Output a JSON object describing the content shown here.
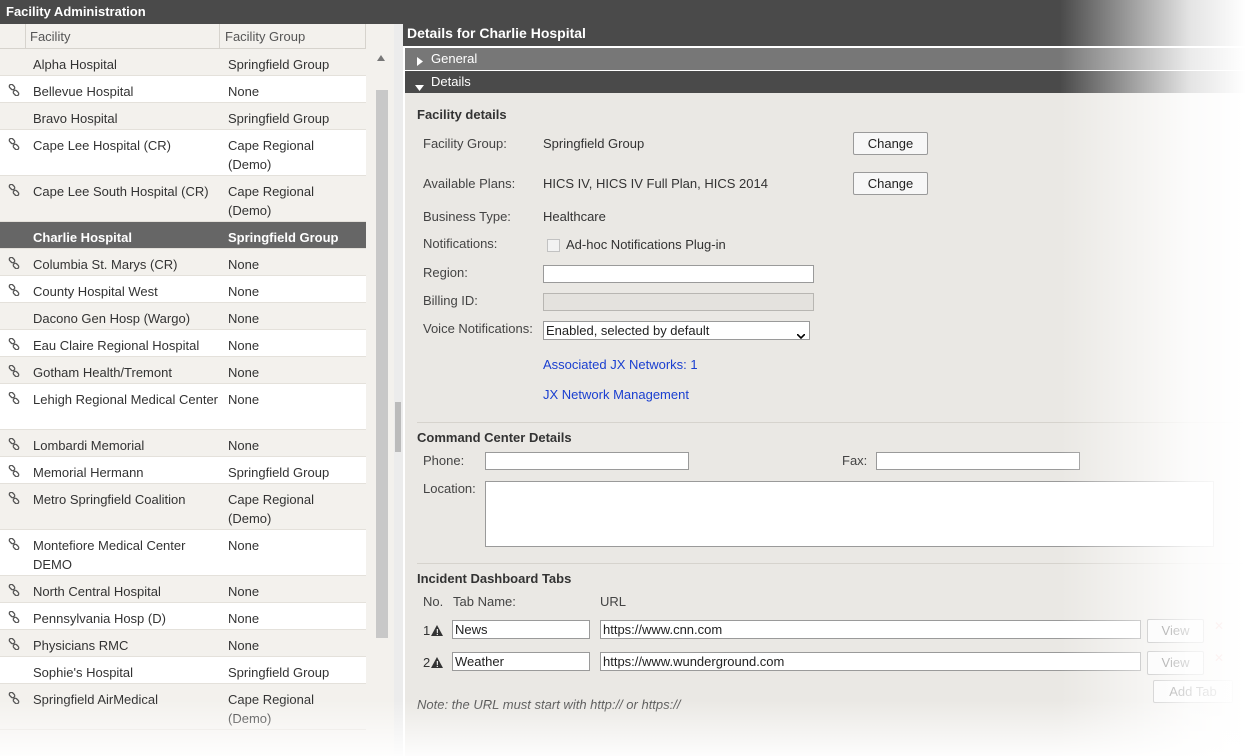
{
  "app_title": "Facility Administration",
  "left": {
    "headers": {
      "facility": "Facility",
      "group": "Facility Group"
    },
    "rows": [
      {
        "facility": "Alpha Hospital",
        "group": "Springfield Group",
        "linked": false
      },
      {
        "facility": "Bellevue Hospital",
        "group": "None",
        "linked": true
      },
      {
        "facility": "Bravo Hospital",
        "group": "Springfield Group",
        "linked": false
      },
      {
        "facility": "Cape Lee Hospital (CR)",
        "group": "Cape Regional (Demo)",
        "linked": true
      },
      {
        "facility": "Cape Lee South Hospital (CR)",
        "group": "Cape Regional (Demo)",
        "linked": true
      },
      {
        "facility": "Charlie Hospital",
        "group": "Springfield Group",
        "linked": false,
        "selected": true
      },
      {
        "facility": "Columbia St. Marys (CR)",
        "group": "None",
        "linked": true
      },
      {
        "facility": "County Hospital West",
        "group": "None",
        "linked": true
      },
      {
        "facility": "Dacono Gen Hosp (Wargo)",
        "group": "None",
        "linked": false
      },
      {
        "facility": "Eau Claire Regional Hospital",
        "group": "None",
        "linked": true
      },
      {
        "facility": "Gotham Health/Tremont",
        "group": "None",
        "linked": true
      },
      {
        "facility": "Lehigh Regional Medical Center",
        "group": "None",
        "linked": true
      },
      {
        "facility": "Lombardi Memorial",
        "group": "None",
        "linked": true
      },
      {
        "facility": "Memorial Hermann",
        "group": "Springfield Group",
        "linked": true
      },
      {
        "facility": "Metro Springfield Coalition",
        "group": "Cape Regional (Demo)",
        "linked": true
      },
      {
        "facility": "Montefiore Medical Center DEMO",
        "group": "None",
        "linked": true
      },
      {
        "facility": "North Central Hospital",
        "group": "None",
        "linked": true
      },
      {
        "facility": "Pennsylvania Hosp (D)",
        "group": "None",
        "linked": true
      },
      {
        "facility": "Physicians RMC",
        "group": "None",
        "linked": true
      },
      {
        "facility": "Sophie's Hospital",
        "group": "Springfield Group",
        "linked": false
      },
      {
        "facility": "Springfield AirMedical",
        "group": "Cape Regional (Demo)",
        "linked": true
      }
    ]
  },
  "right": {
    "title": "Details for Charlie Hospital",
    "sections": {
      "general": "General",
      "details": "Details"
    },
    "facility_details": {
      "heading": "Facility details",
      "facility_group_label": "Facility Group:",
      "facility_group_value": "Springfield Group",
      "change_label": "Change",
      "available_plans_label": "Available Plans:",
      "available_plans_value": "HICS IV, HICS IV Full Plan, HICS 2014",
      "business_type_label": "Business Type:",
      "business_type_value": "Healthcare",
      "notifications_label": "Notifications:",
      "notifications_option": "Ad-hoc Notifications Plug-in",
      "region_label": "Region:",
      "region_value": "",
      "billing_label": "Billing ID:",
      "billing_value": "",
      "voice_label": "Voice Notifications:",
      "voice_selected": "Enabled, selected by default",
      "jx_networks_link": "Associated JX Networks: 1",
      "jx_management_link": "JX Network Management"
    },
    "command_center": {
      "heading": "Command Center Details",
      "phone_label": "Phone:",
      "fax_label": "Fax:",
      "location_label": "Location:",
      "phone_value": "",
      "fax_value": "",
      "location_value": ""
    },
    "incident_tabs": {
      "heading": "Incident Dashboard Tabs",
      "col_no": "No.",
      "col_name": "Tab Name:",
      "col_url": "URL",
      "tabs": [
        {
          "no": "1",
          "name": "News",
          "url": "https://www.cnn.com",
          "view": "View"
        },
        {
          "no": "2",
          "name": "Weather",
          "url": "https://www.wunderground.com",
          "view": "View"
        }
      ],
      "add_tab": "Add Tab",
      "note": "Note: the URL must start with http:// or https://"
    }
  }
}
